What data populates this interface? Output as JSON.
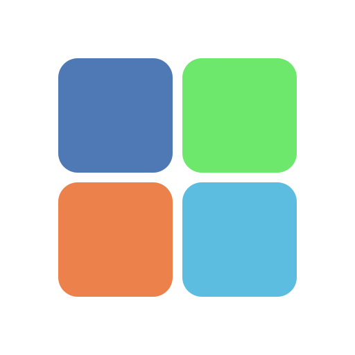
{
  "logo": {
    "tiles": [
      {
        "id": "top-left",
        "color": "#4f79b5"
      },
      {
        "id": "top-right",
        "color": "#6de86c"
      },
      {
        "id": "bottom-left",
        "color": "#ec814c"
      },
      {
        "id": "bottom-right",
        "color": "#5dbde0"
      }
    ]
  },
  "colors": {
    "background": "#ffffff"
  }
}
